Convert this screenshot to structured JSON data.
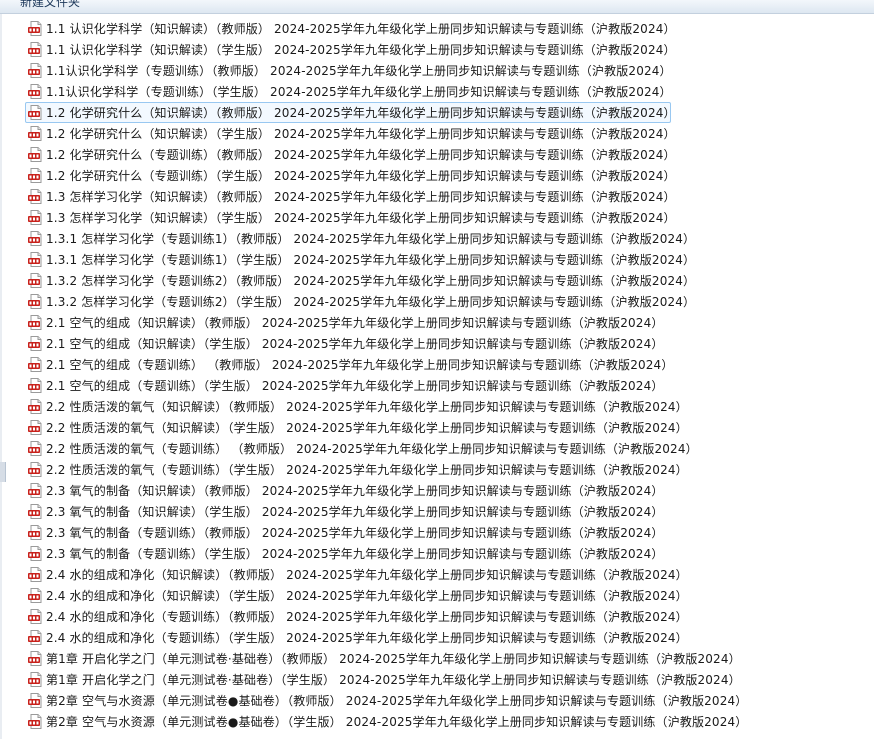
{
  "toolbar": {
    "new_folder_label": "新建文件夹"
  },
  "file_icon": "pdf-file-icon",
  "files": [
    "1.1 认识化学科学（知识解读）（教师版） 2024-2025学年九年级化学上册同步知识解读与专题训练（沪教版2024）",
    "1.1 认识化学科学（知识解读）（学生版） 2024-2025学年九年级化学上册同步知识解读与专题训练（沪教版2024）",
    "1.1认识化学科学（专题训练）（教师版） 2024-2025学年九年级化学上册同步知识解读与专题训练（沪教版2024）",
    "1.1认识化学科学（专题训练）（学生版） 2024-2025学年九年级化学上册同步知识解读与专题训练（沪教版2024）",
    "1.2 化学研究什么（知识解读）（教师版） 2024-2025学年九年级化学上册同步知识解读与专题训练（沪教版2024）",
    "1.2 化学研究什么（知识解读）（学生版） 2024-2025学年九年级化学上册同步知识解读与专题训练（沪教版2024）",
    "1.2 化学研究什么（专题训练）（教师版） 2024-2025学年九年级化学上册同步知识解读与专题训练（沪教版2024）",
    "1.2 化学研究什么（专题训练）（学生版） 2024-2025学年九年级化学上册同步知识解读与专题训练（沪教版2024）",
    "1.3 怎样学习化学（知识解读）（教师版） 2024-2025学年九年级化学上册同步知识解读与专题训练（沪教版2024）",
    "1.3 怎样学习化学（知识解读）（学生版） 2024-2025学年九年级化学上册同步知识解读与专题训练（沪教版2024）",
    "1.3.1 怎样学习化学（专题训练1）（教师版） 2024-2025学年九年级化学上册同步知识解读与专题训练（沪教版2024）",
    "1.3.1 怎样学习化学（专题训练1）（学生版） 2024-2025学年九年级化学上册同步知识解读与专题训练（沪教版2024）",
    "1.3.2 怎样学习化学（专题训练2）（教师版） 2024-2025学年九年级化学上册同步知识解读与专题训练（沪教版2024）",
    "1.3.2 怎样学习化学（专题训练2）（学生版） 2024-2025学年九年级化学上册同步知识解读与专题训练（沪教版2024）",
    "2.1 空气的组成（知识解读）（教师版） 2024-2025学年九年级化学上册同步知识解读与专题训练（沪教版2024）",
    "2.1 空气的组成（知识解读）（学生版） 2024-2025学年九年级化学上册同步知识解读与专题训练（沪教版2024）",
    "2.1 空气的组成（专题训练） （教师版） 2024-2025学年九年级化学上册同步知识解读与专题训练（沪教版2024）",
    "2.1 空气的组成（专题训练）（学生版） 2024-2025学年九年级化学上册同步知识解读与专题训练（沪教版2024）",
    "2.2 性质活泼的氧气（知识解读）（教师版） 2024-2025学年九年级化学上册同步知识解读与专题训练（沪教版2024）",
    "2.2 性质活泼的氧气（知识解读）（学生版） 2024-2025学年九年级化学上册同步知识解读与专题训练（沪教版2024）",
    "2.2 性质活泼的氧气（专题训练） （教师版） 2024-2025学年九年级化学上册同步知识解读与专题训练（沪教版2024）",
    "2.2 性质活泼的氧气（专题训练）（学生版） 2024-2025学年九年级化学上册同步知识解读与专题训练（沪教版2024）",
    "2.3 氧气的制备（知识解读）（教师版） 2024-2025学年九年级化学上册同步知识解读与专题训练（沪教版2024）",
    "2.3 氧气的制备（知识解读）（学生版） 2024-2025学年九年级化学上册同步知识解读与专题训练（沪教版2024）",
    "2.3 氧气的制备（专题训练）（教师版） 2024-2025学年九年级化学上册同步知识解读与专题训练（沪教版2024）",
    "2.3 氧气的制备（专题训练）（学生版） 2024-2025学年九年级化学上册同步知识解读与专题训练（沪教版2024）",
    "2.4 水的组成和净化（知识解读）（教师版） 2024-2025学年九年级化学上册同步知识解读与专题训练（沪教版2024）",
    "2.4 水的组成和净化（知识解读）（学生版） 2024-2025学年九年级化学上册同步知识解读与专题训练（沪教版2024）",
    "2.4 水的组成和净化（专题训练）（教师版） 2024-2025学年九年级化学上册同步知识解读与专题训练（沪教版2024）",
    "2.4 水的组成和净化（专题训练）（学生版） 2024-2025学年九年级化学上册同步知识解读与专题训练（沪教版2024）",
    "第1章 开启化学之门（单元测试卷·基础卷）（教师版） 2024-2025学年九年级化学上册同步知识解读与专题训练（沪教版2024）",
    "第1章 开启化学之门（单元测试卷·基础卷）（学生版） 2024-2025学年九年级化学上册同步知识解读与专题训练（沪教版2024）",
    "第2章 空气与水资源（单元测试卷●基础卷）（教师版） 2024-2025学年九年级化学上册同步知识解读与专题训练（沪教版2024）",
    "第2章 空气与水资源（单元测试卷●基础卷）（学生版） 2024-2025学年九年级化学上册同步知识解读与专题训练（沪教版2024）"
  ],
  "selected_index": 4,
  "colors": {
    "selection_border": "#99c8f1",
    "selection_fill": "#f3f9ff",
    "pdf_red": "#c8211b"
  }
}
